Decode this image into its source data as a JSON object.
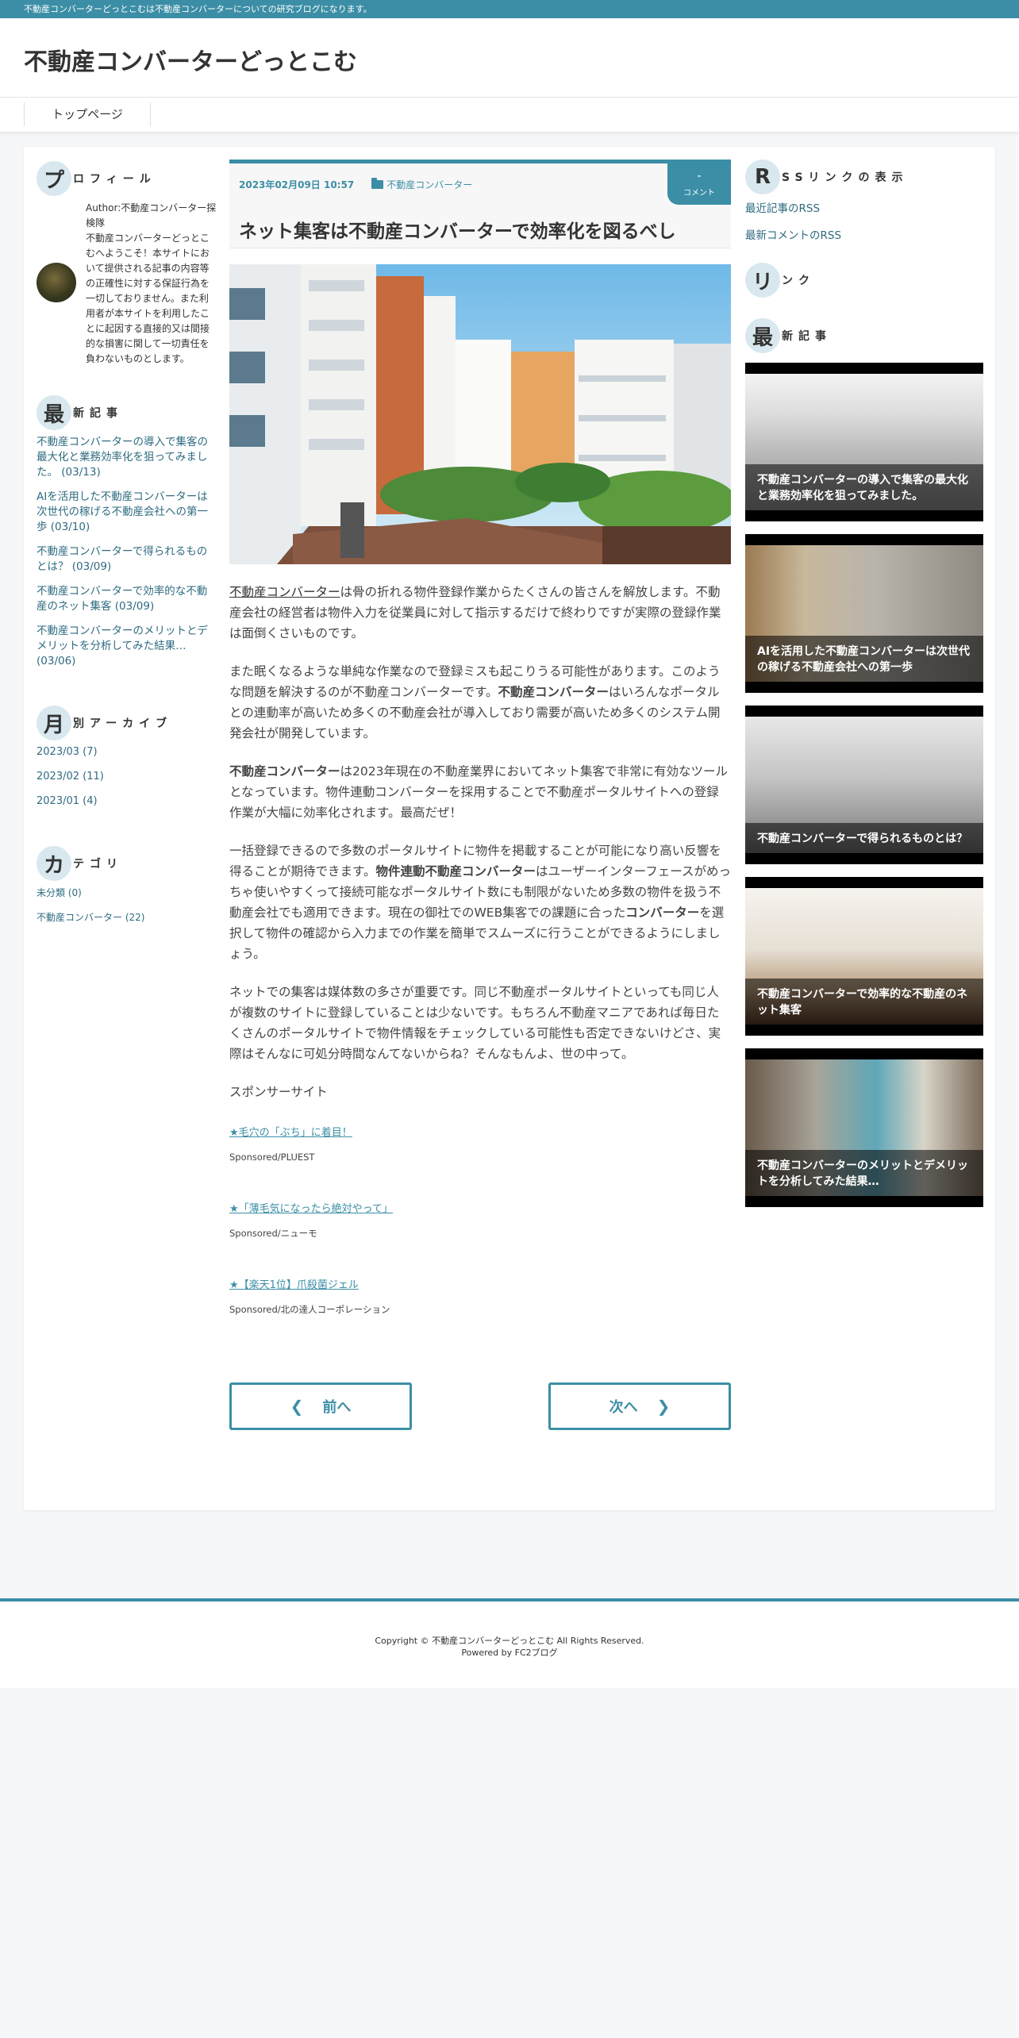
{
  "topbar": {
    "text": "不動産コンバーターどっとこむは不動産コンバーターについての研究ブログになります。"
  },
  "header": {
    "site_title": "不動産コンバーターどっとこむ"
  },
  "nav": {
    "home": "トップページ"
  },
  "left": {
    "profile": {
      "head": "プ",
      "rest": "ロフィール",
      "text": [
        "Author:不動産コンバーター探検隊",
        "不動産コンバーターどっとこむへようこそ！本サイトにおいて提供される記事の内容等の正確性に対する保証行為を一切しておりません。また利用者が本サイトを利用したことに起因する直接的又は間接的な損害に関して一切責任を負わないものとします。"
      ]
    },
    "recent": {
      "head": "最",
      "rest": "新記事",
      "items": [
        "不動産コンバーターの導入で集客の最大化と業務効率化を狙ってみました。 (03/13)",
        "AIを活用した不動産コンバーターは次世代の稼げる不動産会社への第一歩 (03/10)",
        "不動産コンバーターで得られるものとは？ (03/09)",
        "不動産コンバーターで効率的な不動産のネット集客 (03/09)",
        "不動産コンバーターのメリットとデメリットを分析してみた結果… (03/06)"
      ]
    },
    "archive": {
      "head": "月",
      "rest": "別アーカイブ",
      "items": [
        "2023/03 (7)",
        "2023/02 (11)",
        "2023/01 (4)"
      ]
    },
    "category": {
      "head": "カ",
      "rest": "テゴリ",
      "items": [
        "未分類 (0)",
        "不動産コンバーター (22)"
      ]
    }
  },
  "article": {
    "date": "2023年02月09日 10:57",
    "category": "不動産コンバーター",
    "comment_count": "-",
    "comment_label": "コメント",
    "title": "ネット集客は不動産コンバーターで効率化を図るべし",
    "p1_link": "不動産コンバーター",
    "p1_rest": "は骨の折れる物件登録作業からたくさんの皆さんを解放します。不動産会社の経営者は物件入力を従業員に対して指示するだけで終わりですが実際の登録作業は面倒くさいものです。",
    "p2_a": "また眠くなるような単純な作業なので登録ミスも起こりうる可能性があります。このような問題を解決するのが不動産コンバーターです。",
    "p2_b": "不動産コンバーター",
    "p2_c": "はいろんなポータルとの連動率が高いため多くの不動産会社が導入しており需要が高いため多くのシステム開発会社が開発しています。",
    "p3_b": "不動産コンバーター",
    "p3_c": "は2023年現在の不動産業界においてネット集客で非常に有効なツールとなっています。物件連動コンバーターを採用することで不動産ポータルサイトへの登録作業が大幅に効率化されます。最高だぜ！",
    "p4_a": "一括登録できるので多数のポータルサイトに物件を掲載することが可能になり高い反響を得ることが期待できます。",
    "p4_b": "物件連動不動産コンバーター",
    "p4_c": "はユーザーインターフェースがめっちゃ使いやすくって接続可能なポータルサイト数にも制限がないため多数の物件を扱う不動産会社でも適用できます。現在の御社でのWEB集客での課題に合った",
    "p4_d": "コンバーター",
    "p4_e": "を選択して物件の確認から入力までの作業を簡単でスムーズに行うことができるようにしましょう。",
    "p5": "ネットでの集客は媒体数の多さが重要です。同じ不動産ポータルサイトといっても同じ人が複数のサイトに登録していることは少ないです。もちろん不動産マニアであれば毎日たくさんのポータルサイトで物件情報をチェックしている可能性も否定できないけどさ、実際はそんなに可処分時間なんてないからね？そんなもんよ、世の中って。",
    "sponsor_head": "スポンサーサイト",
    "sponsors": [
      {
        "title": "★毛穴の「ぶち」に着目！",
        "by": "Sponsored/PLUEST"
      },
      {
        "title": "★「薄毛気になったら絶対やって」",
        "by": "Sponsored/ニューモ"
      },
      {
        "title": "★【楽天1位】爪殺菌ジェル",
        "by": "Sponsored/北の達人コーポレーション"
      }
    ],
    "prev": "前へ",
    "next": "次へ"
  },
  "right": {
    "rss": {
      "head": "R",
      "rest": "SSリンクの表示",
      "items": [
        "最近記事のRSS",
        "最新コメントのRSS"
      ]
    },
    "links": {
      "head": "リ",
      "rest": "ンク"
    },
    "recent": {
      "head": "最",
      "rest": "新記事",
      "cards": [
        "不動産コンバーターの導入で集客の最大化と業務効率化を狙ってみました。",
        "AIを活用した不動産コンバーターは次世代の稼げる不動産会社への第一歩",
        "不動産コンバーターで得られるものとは？",
        "不動産コンバーターで効率的な不動産のネット集客",
        "不動産コンバーターのメリットとデメリットを分析してみた結果…"
      ]
    }
  },
  "footer": {
    "copyright": "Copyright © 不動産コンバーターどっとこむ All Rights Reserved.",
    "powered": "Powered by FC2ブログ"
  },
  "colors": {
    "accent": "#3b8ea5",
    "link": "#2f6b80"
  }
}
